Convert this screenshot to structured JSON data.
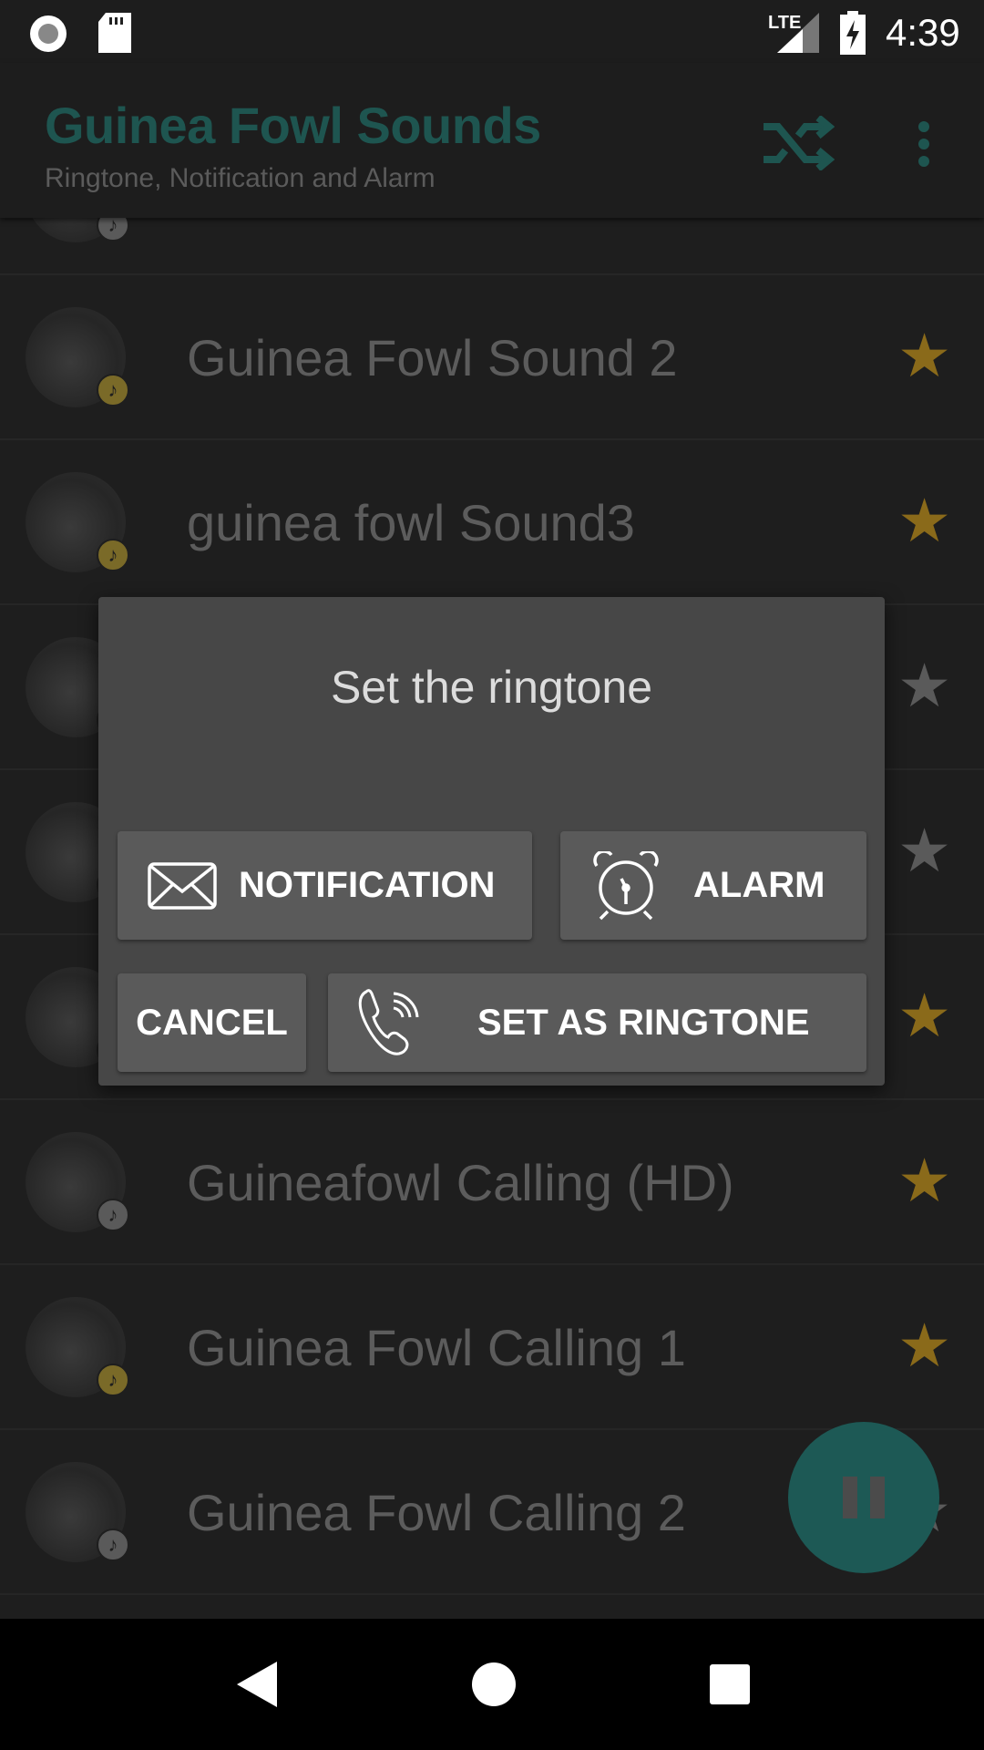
{
  "status_bar": {
    "time": "4:39",
    "network": "LTE",
    "icons": [
      "record-icon",
      "sd-card-icon",
      "signal-icon",
      "battery-charging-icon"
    ]
  },
  "app_bar": {
    "title": "Guinea Fowl Sounds",
    "subtitle": "Ringtone, Notification and Alarm",
    "actions": [
      "shuffle-icon",
      "more-vert-icon"
    ]
  },
  "colors": {
    "accent": "#1e5550",
    "star_favorite": "#8a6a1a",
    "star_normal": "#5a5a5a",
    "dialog": "#474747",
    "button": "#5a5a5a"
  },
  "list": {
    "items": [
      {
        "name": "",
        "favorite": true,
        "badge": "gray"
      },
      {
        "name": "Guinea Fowl Sound 2",
        "favorite": true,
        "badge": "gold"
      },
      {
        "name": "guinea fowl Sound3",
        "favorite": true,
        "badge": "gold"
      },
      {
        "name": "",
        "favorite": false,
        "badge": "gray"
      },
      {
        "name": "",
        "favorite": false,
        "badge": "gray"
      },
      {
        "name": "",
        "favorite": true,
        "badge": "gray"
      },
      {
        "name": "Guineafowl Calling (HD)",
        "favorite": true,
        "badge": "gray"
      },
      {
        "name": "Guinea Fowl Calling 1",
        "favorite": true,
        "badge": "gold"
      },
      {
        "name": "Guinea Fowl Calling 2",
        "favorite": false,
        "badge": "gray"
      }
    ]
  },
  "dialog": {
    "title": "Set the ringtone",
    "notification": "NOTIFICATION",
    "alarm": "ALARM",
    "cancel": "CANCEL",
    "set_ringtone": "SET AS RINGTONE"
  },
  "fab": {
    "icon": "pause-icon"
  },
  "nav": {
    "icons": [
      "back-icon",
      "home-icon",
      "recents-icon"
    ]
  }
}
